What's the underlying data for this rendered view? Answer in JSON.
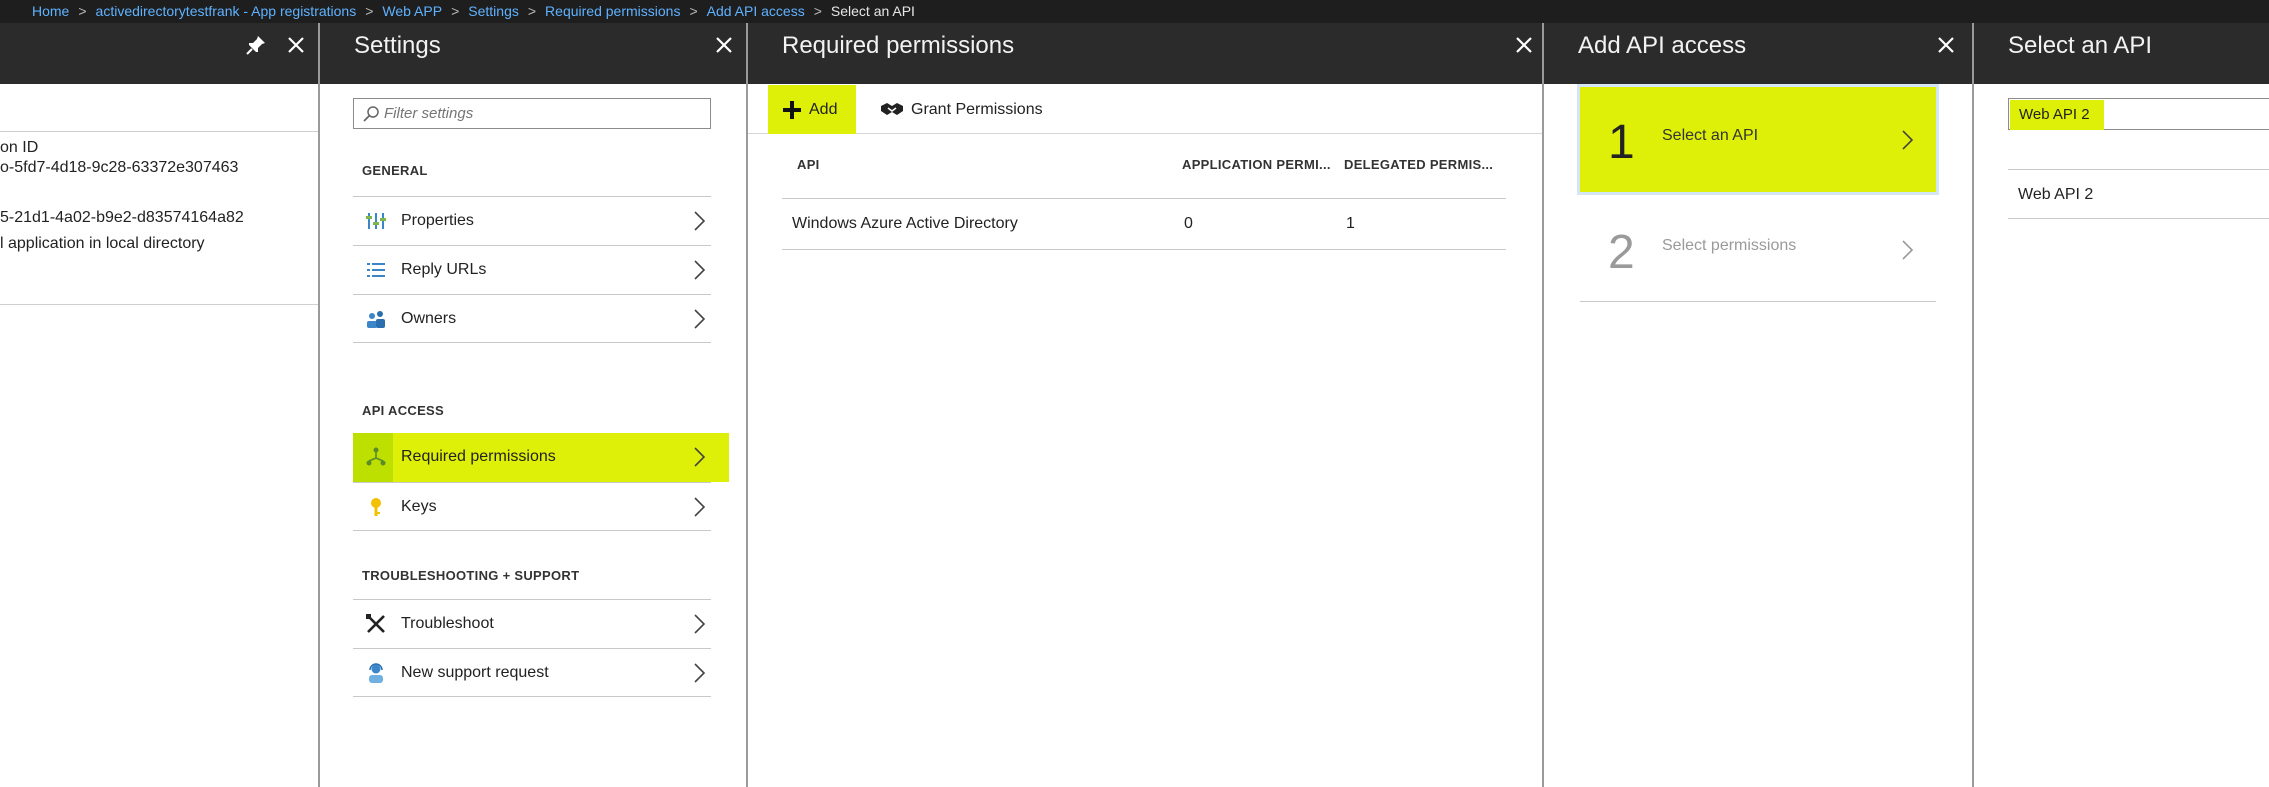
{
  "breadcrumb": {
    "items": [
      "Home",
      "activedirectorytestfrank - App registrations",
      "Web APP",
      "Settings",
      "Required permissions",
      "Add API access"
    ],
    "current": "Select an API"
  },
  "blade1": {
    "lines": [
      "on ID",
      "o-5fd7-4d18-9c28-63372e307463",
      "5-21d1-4a02-b9e2-d83574164a82",
      "l application in local directory"
    ]
  },
  "settings": {
    "title": "Settings",
    "filter_placeholder": "Filter settings",
    "sections": [
      {
        "label": "GENERAL",
        "items": [
          {
            "label": "Properties",
            "icon": "properties-icon"
          },
          {
            "label": "Reply URLs",
            "icon": "list-icon"
          },
          {
            "label": "Owners",
            "icon": "owners-icon"
          }
        ]
      },
      {
        "label": "API ACCESS",
        "items": [
          {
            "label": "Required permissions",
            "icon": "permissions-icon"
          },
          {
            "label": "Keys",
            "icon": "key-icon"
          }
        ]
      },
      {
        "label": "TROUBLESHOOTING + SUPPORT",
        "items": [
          {
            "label": "Troubleshoot",
            "icon": "tools-icon"
          },
          {
            "label": "New support request",
            "icon": "support-icon"
          }
        ]
      }
    ],
    "highlight_color": "#dff008"
  },
  "required_permissions": {
    "title": "Required permissions",
    "toolbar": {
      "add_label": "Add",
      "grant_label": "Grant Permissions"
    },
    "columns": [
      "API",
      "APPLICATION PERMI...",
      "DELEGATED PERMIS..."
    ],
    "rows": [
      {
        "api": "Windows Azure Active Directory",
        "application": "0",
        "delegated": "1"
      }
    ]
  },
  "add_api_access": {
    "title": "Add API access",
    "steps": [
      {
        "num": "1",
        "label": "Select an API"
      },
      {
        "num": "2",
        "label": "Select permissions"
      }
    ]
  },
  "select_api": {
    "title": "Select an API",
    "search_value": "Web API 2",
    "results": [
      "Web API 2"
    ]
  }
}
